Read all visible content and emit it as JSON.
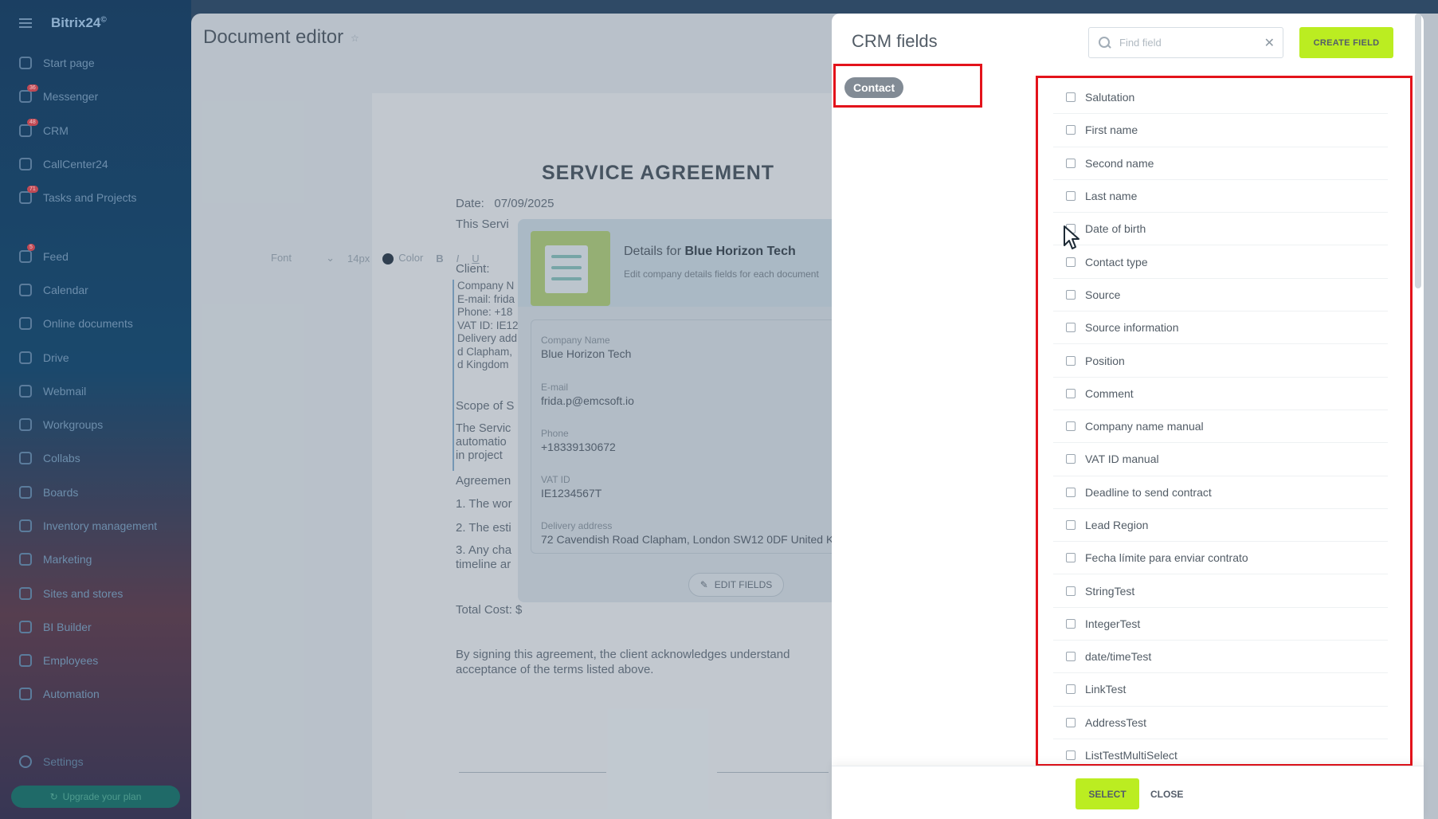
{
  "sidebar": {
    "brand": "Bitrix24",
    "items": [
      {
        "label": "Start page",
        "badge": ""
      },
      {
        "label": "Messenger",
        "badge": "36"
      },
      {
        "label": "CRM",
        "badge": "48"
      },
      {
        "label": "CallCenter24",
        "badge": ""
      },
      {
        "label": "Tasks and Projects",
        "badge": "71"
      },
      {
        "label": "Feed",
        "badge": "5"
      },
      {
        "label": "Calendar",
        "badge": ""
      },
      {
        "label": "Online documents",
        "badge": ""
      },
      {
        "label": "Drive",
        "badge": ""
      },
      {
        "label": "Webmail",
        "badge": ""
      },
      {
        "label": "Workgroups",
        "badge": ""
      },
      {
        "label": "Collabs",
        "badge": ""
      },
      {
        "label": "Boards",
        "badge": ""
      },
      {
        "label": "Inventory management",
        "badge": ""
      },
      {
        "label": "Marketing",
        "badge": ""
      },
      {
        "label": "Sites and stores",
        "badge": ""
      },
      {
        "label": "BI Builder",
        "badge": ""
      },
      {
        "label": "Employees",
        "badge": ""
      },
      {
        "label": "Automation",
        "badge": ""
      }
    ],
    "settings": "Settings",
    "upgrade": "Upgrade your plan"
  },
  "editor": {
    "title": "Document editor",
    "toolbar": {
      "font": "Font",
      "size": "14px",
      "color": "Color",
      "bold": "B",
      "italic": "I",
      "underline": "U"
    },
    "doc": {
      "heading": "SERVICE AGREEMENT",
      "date_label": "Date:",
      "date_value": "07/09/2025",
      "intro": "This Servi",
      "client": "Client:",
      "client_lines": [
        "Company N",
        "E-mail: frida",
        "Phone: +18",
        "VAT ID: IE12",
        "Delivery add",
        "d Clapham,",
        "d Kingdom"
      ],
      "scope": "Scope of S",
      "scope_lines": [
        "The Servic",
        "automatio",
        "in project"
      ],
      "agreement": "Agreemen",
      "items": [
        "1. The wor",
        "2. The esti",
        "3. Any cha",
        "timeline ar"
      ],
      "total": "Total Cost: $",
      "closing_1": "By signing this agreement, the client acknowledges understand",
      "closing_2": "acceptance of the terms listed above."
    },
    "details": {
      "title_prefix": "Details for",
      "company": "Blue Horizon Tech",
      "subtitle": "Edit company details fields for each document",
      "fields": [
        {
          "label": "Company Name",
          "value": "Blue Horizon Tech"
        },
        {
          "label": "E-mail",
          "value": "frida.p@emcsoft.io"
        },
        {
          "label": "Phone",
          "value": "+18339130672"
        },
        {
          "label": "VAT ID",
          "value": "IE1234567T"
        },
        {
          "label": "Delivery address",
          "value": "72 Cavendish Road Clapham, London SW12 0DF United K"
        }
      ],
      "edit_button": "EDIT FIELDS"
    }
  },
  "crm": {
    "title": "CRM fields",
    "search_placeholder": "Find field",
    "create_button": "CREATE FIELD",
    "entity": "Contact",
    "fields": [
      "Salutation",
      "First name",
      "Second name",
      "Last name",
      "Date of birth",
      "Contact type",
      "Source",
      "Source information",
      "Position",
      "Comment",
      "Company name manual",
      "VAT ID manual",
      "Deadline to send contract",
      "Lead Region",
      "Fecha límite para enviar contrato",
      "StringTest",
      "IntegerTest",
      "date/timeTest",
      "LinkTest",
      "AddressTest",
      "ListTestMultiSelect"
    ],
    "select_button": "SELECT",
    "close_button": "CLOSE"
  },
  "colors": {
    "accent_green": "#bbed21",
    "highlight_red": "#e3131b",
    "close_blue": "#2fa9f0"
  }
}
